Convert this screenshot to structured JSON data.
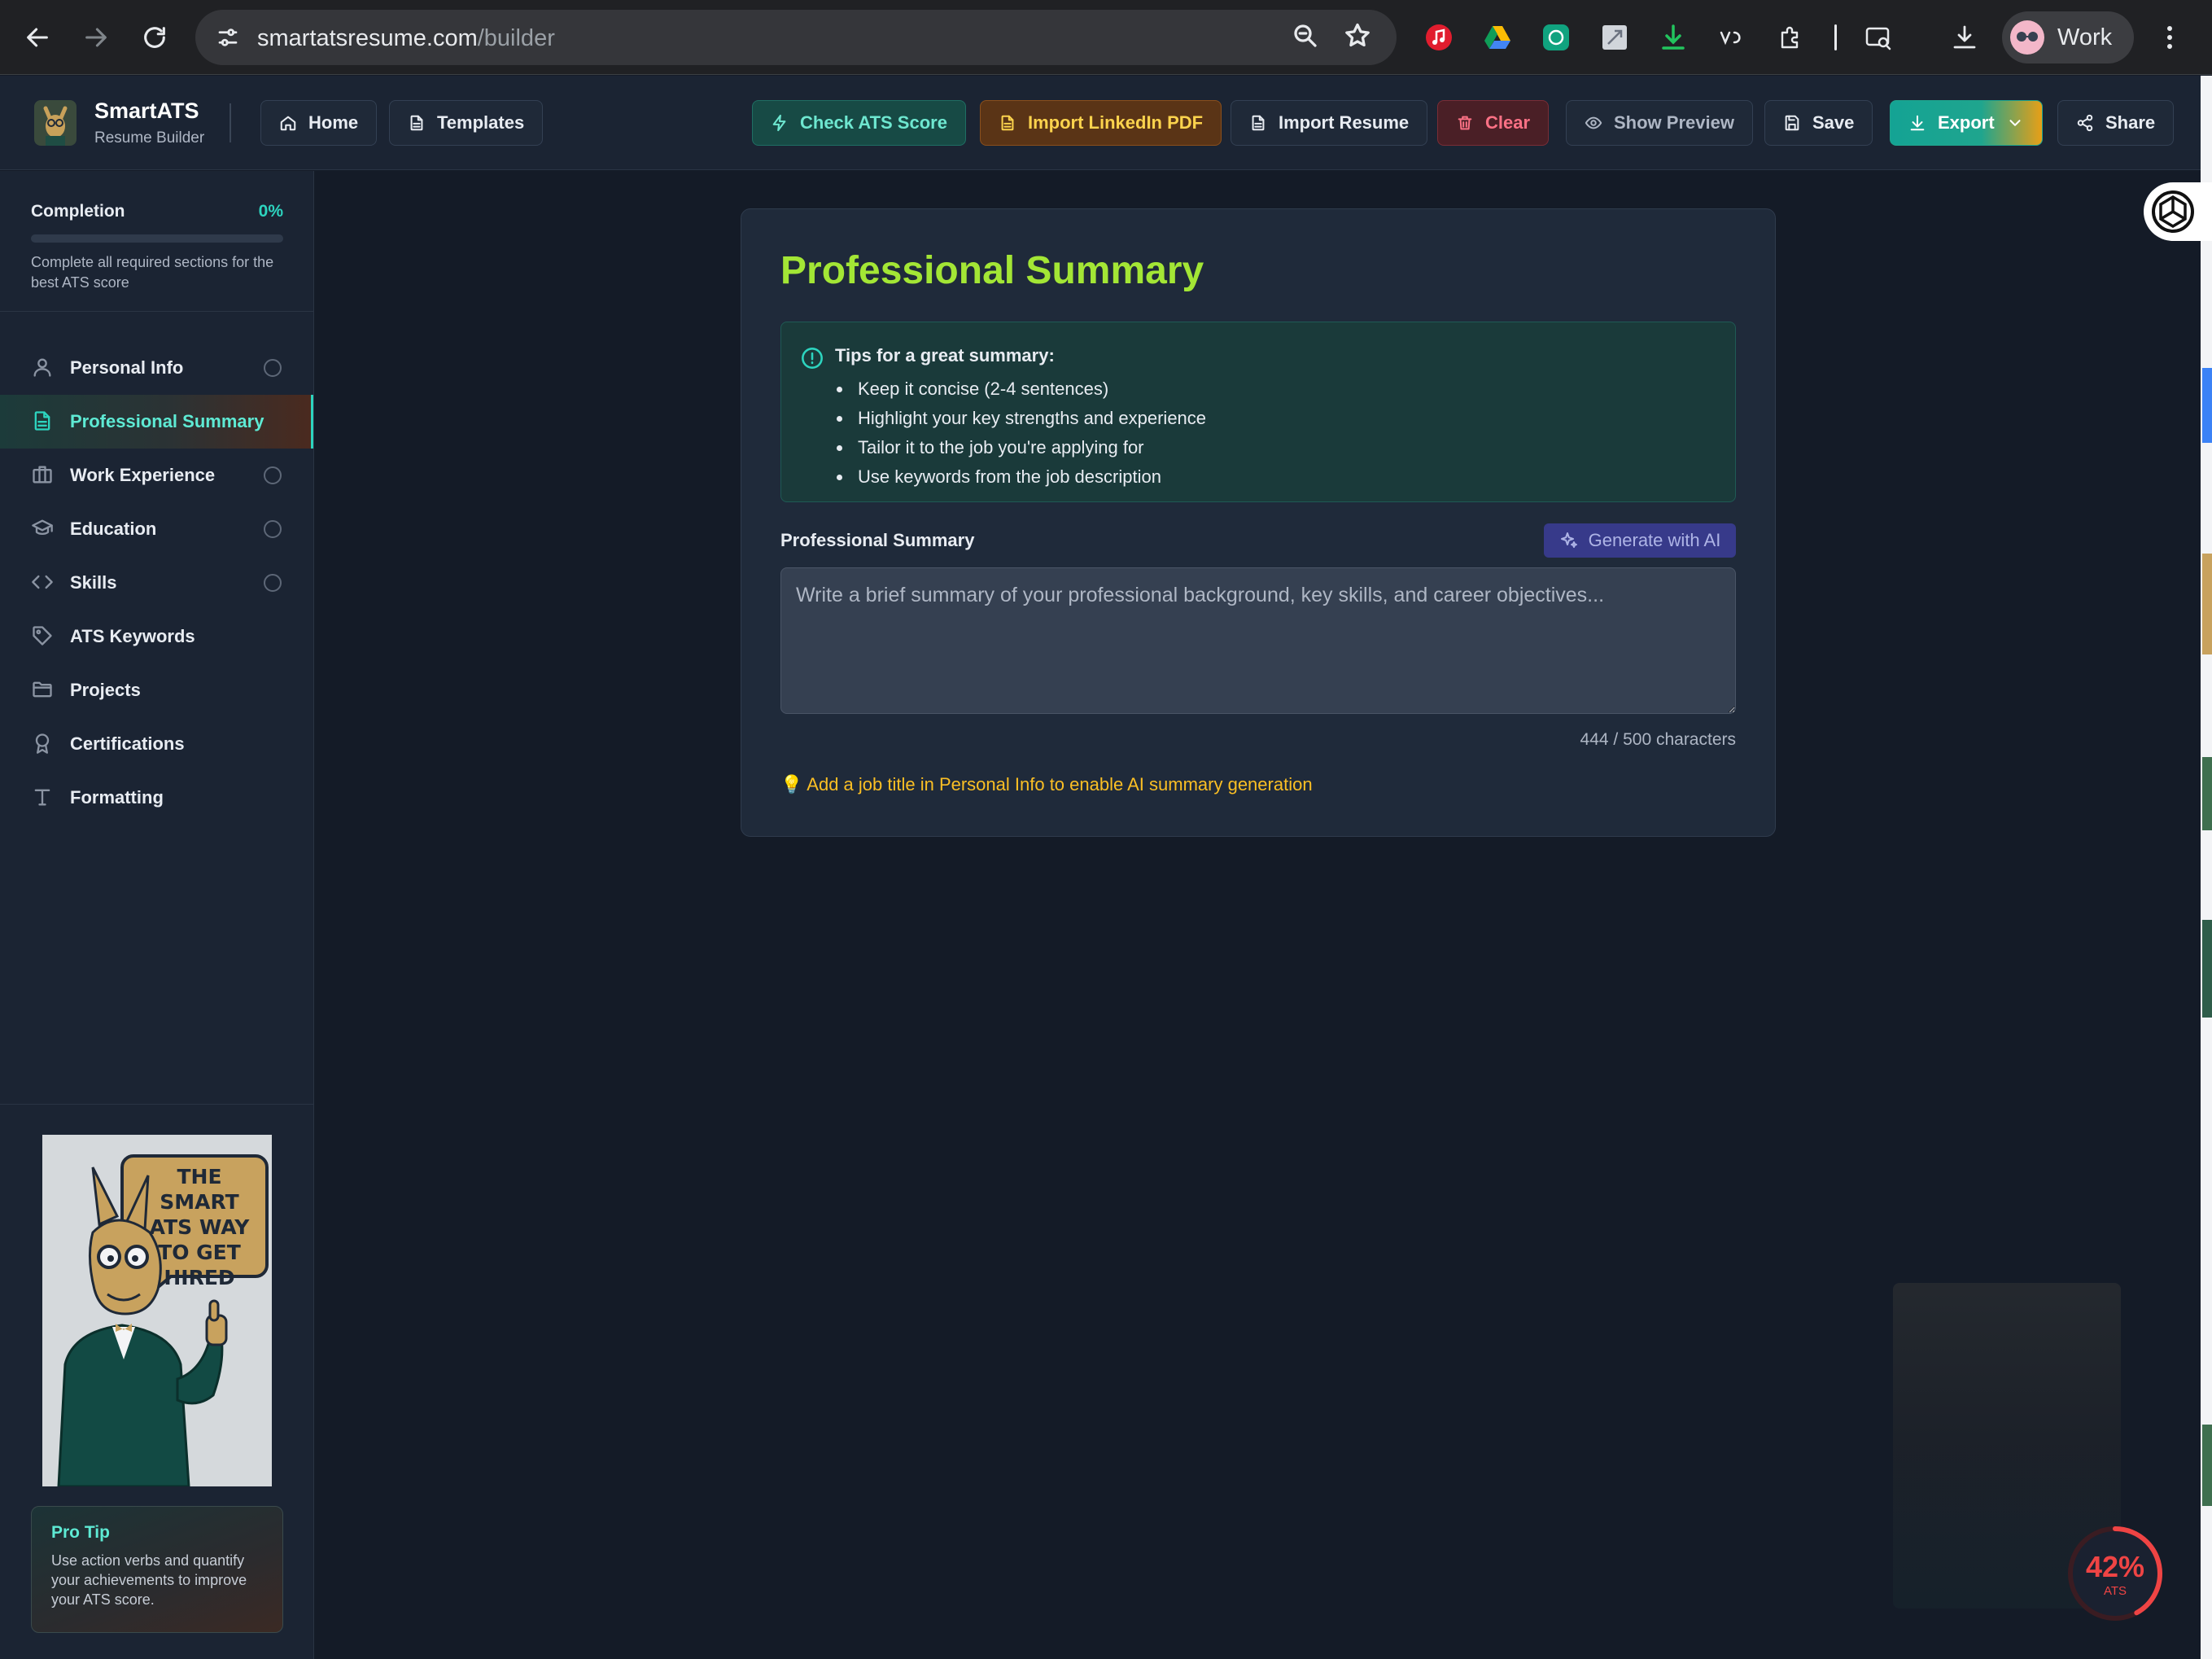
{
  "browser": {
    "url_domain": "smartatsresume.com",
    "url_path": "/builder",
    "profile_label": "Work",
    "icons": [
      "back-arrow-icon",
      "forward-arrow-icon",
      "reload-icon",
      "site-info-icon",
      "zoom-icon",
      "bookmark-star-icon",
      "extensions-icon",
      "downloads-icon",
      "kebab-menu-icon"
    ]
  },
  "header": {
    "brand": "SmartATS",
    "brand_sub": "Resume Builder",
    "nav": [
      {
        "label": "Home",
        "icon": "home-icon"
      },
      {
        "label": "Templates",
        "icon": "document-icon"
      }
    ],
    "actions": [
      {
        "label": "Check ATS Score",
        "icon": "lightning-icon"
      },
      {
        "label": "Import LinkedIn PDF",
        "icon": "document-icon"
      },
      {
        "label": "Import Resume",
        "icon": "document-icon"
      },
      {
        "label": "Clear",
        "icon": "trash-icon"
      },
      {
        "label": "Show Preview",
        "icon": "eye-icon"
      },
      {
        "label": "Save",
        "icon": "save-icon"
      },
      {
        "label": "Export",
        "icon": "download-icon"
      },
      {
        "label": "Share",
        "icon": "share-icon"
      }
    ]
  },
  "sidebar": {
    "completion_label": "Completion",
    "completion_value": "0%",
    "completion_fraction": 0,
    "completion_hint": "Complete all required sections for the best ATS score",
    "items": [
      {
        "label": "Personal Info",
        "icon": "user-icon",
        "has_status": true
      },
      {
        "label": "Professional Summary",
        "icon": "document-icon",
        "active": true
      },
      {
        "label": "Work Experience",
        "icon": "briefcase-icon",
        "has_status": true
      },
      {
        "label": "Education",
        "icon": "graduation-cap-icon",
        "has_status": true
      },
      {
        "label": "Skills",
        "icon": "code-icon",
        "has_status": true
      },
      {
        "label": "ATS Keywords",
        "icon": "tag-icon"
      },
      {
        "label": "Projects",
        "icon": "folder-icon"
      },
      {
        "label": "Certifications",
        "icon": "award-icon"
      },
      {
        "label": "Formatting",
        "icon": "type-icon"
      }
    ],
    "mascot_text": "THE SMART ATS WAY TO GET HIRED",
    "protip_title": "Pro Tip",
    "protip_text": "Use action verbs and quantify your achievements to improve your ATS score."
  },
  "main": {
    "title": "Professional Summary",
    "tips_title": "Tips for a great summary:",
    "tips": [
      "Keep it concise (2-4 sentences)",
      "Highlight your key strengths and experience",
      "Tailor it to the job you're applying for",
      "Use keywords from the job description"
    ],
    "field_label": "Professional Summary",
    "ai_button": "Generate with AI",
    "placeholder": "Write a brief summary of your professional background, key skills, and career objectives...",
    "char_count": "444 / 500 characters",
    "ai_hint": "💡 Add a job title in Personal Info to enable AI summary generation"
  },
  "ats_badge": {
    "value": "42%",
    "label": "ATS",
    "score_fraction": 0.42,
    "color": "#ef4444"
  },
  "colors": {
    "accent_teal": "#2dd4bf",
    "title_lime": "#a3e635",
    "hint_amber": "#fbbf24",
    "background": "#141b27"
  }
}
